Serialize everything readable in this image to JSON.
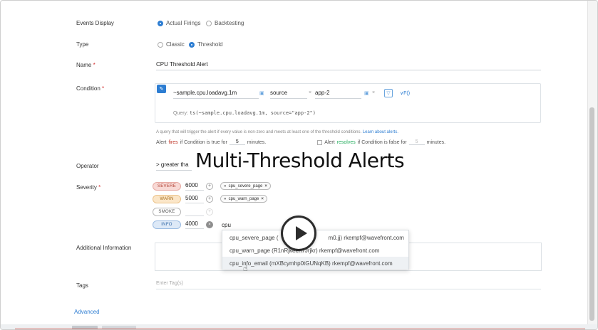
{
  "overlay": {
    "title": "Multi-Threshold Alerts"
  },
  "form": {
    "events_display": {
      "label": "Events Display",
      "options": [
        "Actual Firings",
        "Backtesting"
      ],
      "selected": "Actual Firings"
    },
    "type": {
      "label": "Type",
      "options": [
        "Classic",
        "Threshold"
      ],
      "selected": "Threshold"
    },
    "name": {
      "label": "Name",
      "required_mark": "*",
      "value": "CPU Threshold Alert"
    },
    "condition": {
      "label": "Condition",
      "required_mark": "*",
      "metric": "~sample.cpu.loadavg.1m",
      "filter_key": "source",
      "filter_value": "app-2",
      "fx_label": "∨F()",
      "query_prefix": "Query:",
      "query": "ts(~sample.cpu.loadavg.1m, source=\"app-2\")",
      "hint": "A query that will trigger the alert if every value is non-zero and meets at least one of the threshold conditions.",
      "hint_link": "Learn about alerts.",
      "fires_pre": "Alert",
      "fires_word": "fires",
      "fires_post": "if Condition is true for",
      "fires_minutes": "5",
      "minutes_label": "minutes.",
      "resolves_pre": "Alert",
      "resolves_word": "resolves",
      "resolves_post": "if Condition is false for",
      "resolves_minutes": "5",
      "resolves_minutes_label": "minutes."
    },
    "operator": {
      "label": "Operator",
      "value": "> greater tha"
    },
    "severity": {
      "label": "Severity",
      "required_mark": "*",
      "levels": [
        {
          "tag": "SEVERE",
          "value": "6000",
          "target": "cpu_severe_page"
        },
        {
          "tag": "WARN",
          "value": "5000",
          "target": "cpu_warn_page"
        },
        {
          "tag": "SMOKE",
          "value": "",
          "target": ""
        },
        {
          "tag": "INFO",
          "value": "4000",
          "target": ""
        }
      ],
      "typed_text": "cpu",
      "suggestions": [
        "cpu_severe_page (",
        "m0.jj) rkempf@wavefront.com",
        "cpu_warn_page (R1nRjkeen7Jrjkr) rkempf@wavefront.com",
        "cpu_info_email (mXBcymhp0tGUNqKB) rkempf@wavefront.com"
      ]
    },
    "additional_info": {
      "label": "Additional Information"
    },
    "tags": {
      "label": "Tags",
      "placeholder": "Enter Tag(s)"
    },
    "advanced": {
      "label": "Advanced"
    }
  },
  "icons": {
    "condition_edit": "✎",
    "metric_icon": "▣",
    "filter_icon": "▽",
    "plus_icon": "+",
    "close_icon": "×",
    "cursor_icon": "☝"
  }
}
